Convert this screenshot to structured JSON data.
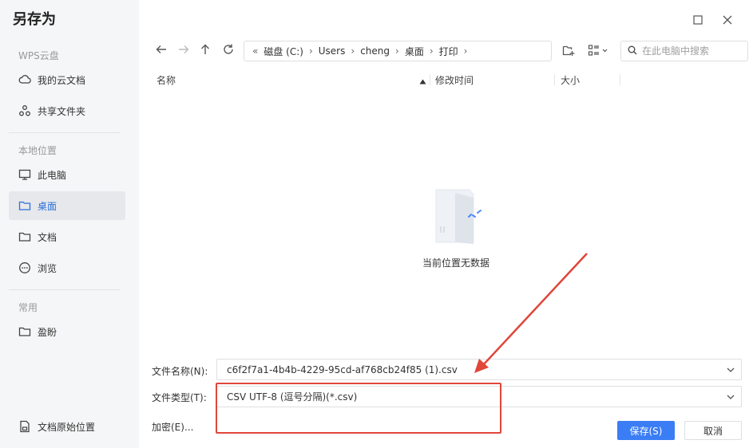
{
  "dialog": {
    "title": "另存为"
  },
  "sidebar": {
    "sections": [
      {
        "label": "WPS云盘"
      },
      {
        "label": "本地位置"
      },
      {
        "label": "常用"
      }
    ],
    "items": [
      {
        "label": "我的云文档",
        "icon": "cloud-icon"
      },
      {
        "label": "共享文件夹",
        "icon": "share-icon"
      },
      {
        "label": "此电脑",
        "icon": "monitor-icon"
      },
      {
        "label": "桌面",
        "icon": "folder-icon",
        "active": true
      },
      {
        "label": "文档",
        "icon": "folder-icon"
      },
      {
        "label": "浏览",
        "icon": "more-icon"
      },
      {
        "label": "盈盼",
        "icon": "folder-icon"
      }
    ],
    "footer": {
      "label": "文档原始位置",
      "icon": "document-location-icon"
    }
  },
  "window": {
    "maximize_icon": "maximize-icon",
    "close_icon": "close-icon"
  },
  "toolbar": {
    "back_icon": "arrow-left-icon",
    "forward_icon": "arrow-right-icon",
    "up_icon": "arrow-up-icon",
    "refresh_icon": "refresh-icon",
    "path": {
      "prefix": "«",
      "crumbs": [
        "磁盘 (C:)",
        "Users",
        "cheng",
        "桌面",
        "打印"
      ]
    },
    "new_folder_icon": "new-folder-icon",
    "view_icon": "view-mode-icon",
    "search": {
      "placeholder": "在此电脑中搜索",
      "value": ""
    }
  },
  "columns": {
    "name": "名称",
    "modified": "修改时间",
    "size": "大小"
  },
  "empty_state": {
    "text": "当前位置无数据",
    "icon": "empty-folder-icon"
  },
  "form": {
    "filename": {
      "label": "文件名称(N):",
      "value": "c6f2f7a1-4b4b-4229-95cd-af768cb24f85 (1).csv"
    },
    "filetype": {
      "label": "文件类型(T):",
      "value": "CSV UTF-8 (逗号分隔)(*.csv)"
    },
    "encrypt_label": "加密(E)..."
  },
  "buttons": {
    "save": "保存(S)",
    "cancel": "取消"
  },
  "colors": {
    "accent": "#3a7df5",
    "active_text": "#2c6fdb",
    "annotation": "#e0463a",
    "sidebar_bg": "#f5f6f7"
  }
}
